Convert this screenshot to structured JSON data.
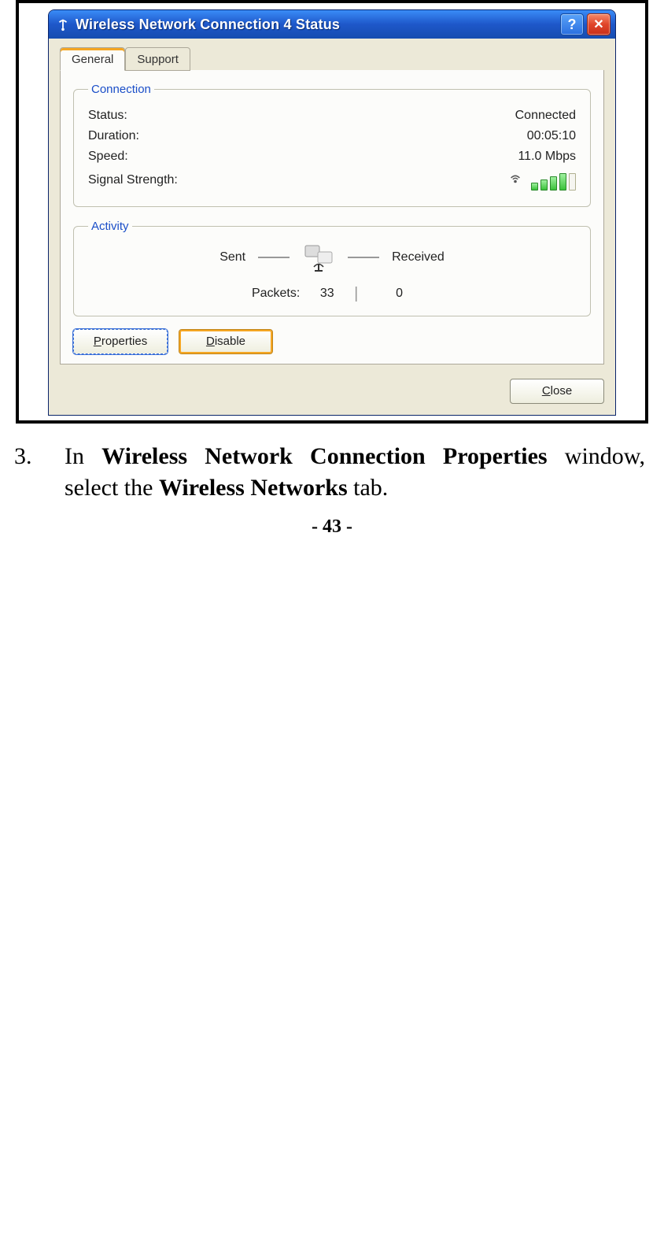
{
  "window": {
    "title": "Wireless Network Connection 4 Status",
    "tabs": {
      "general": "General",
      "support": "Support"
    },
    "connection": {
      "legend": "Connection",
      "status_label": "Status:",
      "status_value": "Connected",
      "duration_label": "Duration:",
      "duration_value": "00:05:10",
      "speed_label": "Speed:",
      "speed_value": "11.0 Mbps",
      "signal_label": "Signal Strength:"
    },
    "activity": {
      "legend": "Activity",
      "sent_label": "Sent",
      "received_label": "Received",
      "packets_label": "Packets:",
      "packets_sent": "33",
      "packets_received": "0"
    },
    "buttons": {
      "properties": "Properties",
      "disable": "Disable",
      "close": "Close"
    }
  },
  "instruction": {
    "number": "3.",
    "text_prefix": "In ",
    "bold1": "Wireless Network Connection Properties",
    "text_mid": " window, select the ",
    "bold2": "Wireless Networks",
    "text_suffix": " tab."
  },
  "page_number": "- 43 -"
}
